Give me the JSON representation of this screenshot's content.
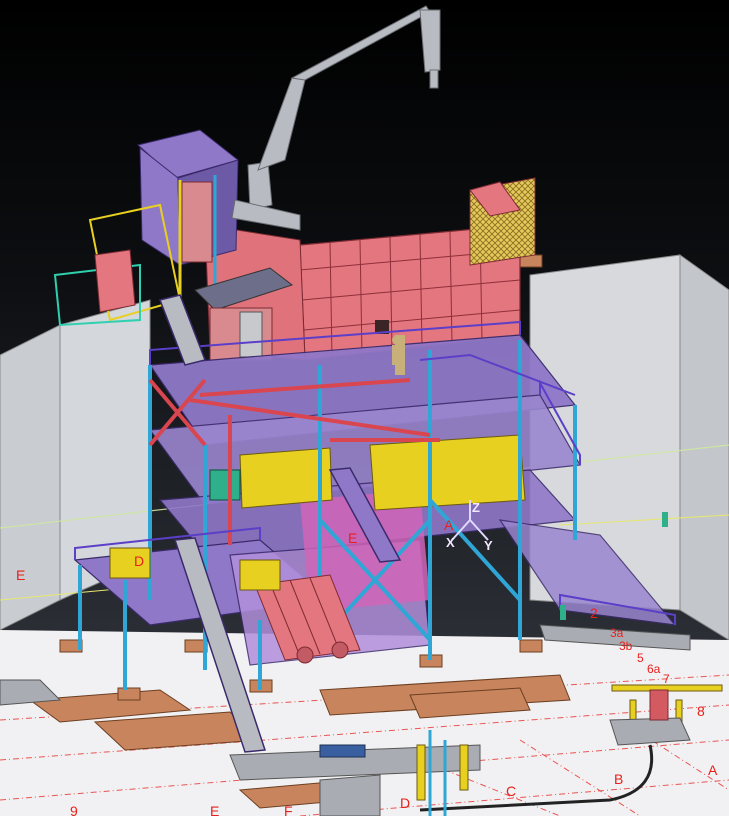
{
  "grid_labels": {
    "E_left": "E",
    "D_left": "D",
    "E_mid": "E",
    "A_mid": "A",
    "two": "2",
    "three_a": "3a",
    "three_b": "3b",
    "five": "5",
    "six_a": "6a",
    "seven": "7",
    "eight": "8",
    "A_bottom": "A",
    "B_bottom": "B",
    "C_bottom": "C",
    "D_bottom": "D",
    "E_bottom": "E",
    "F_bottom": "F",
    "nine": "9"
  },
  "axis_triad": {
    "x": "X",
    "y": "Y",
    "z": "Z"
  },
  "colors": {
    "background_top": "#000000",
    "background_bottom": "#3a3f47",
    "wall": "#d7d9dd",
    "floor": "#f1f1f3",
    "steel_blue": "#2fa6d6",
    "deck_purple": "#8f78c8",
    "module_pink": "#e4767f",
    "equipment_yellow": "#e8d020",
    "foundation_brown": "#c8845c",
    "grid_red": "#e8201c",
    "crane_grey": "#b8bcc2"
  }
}
